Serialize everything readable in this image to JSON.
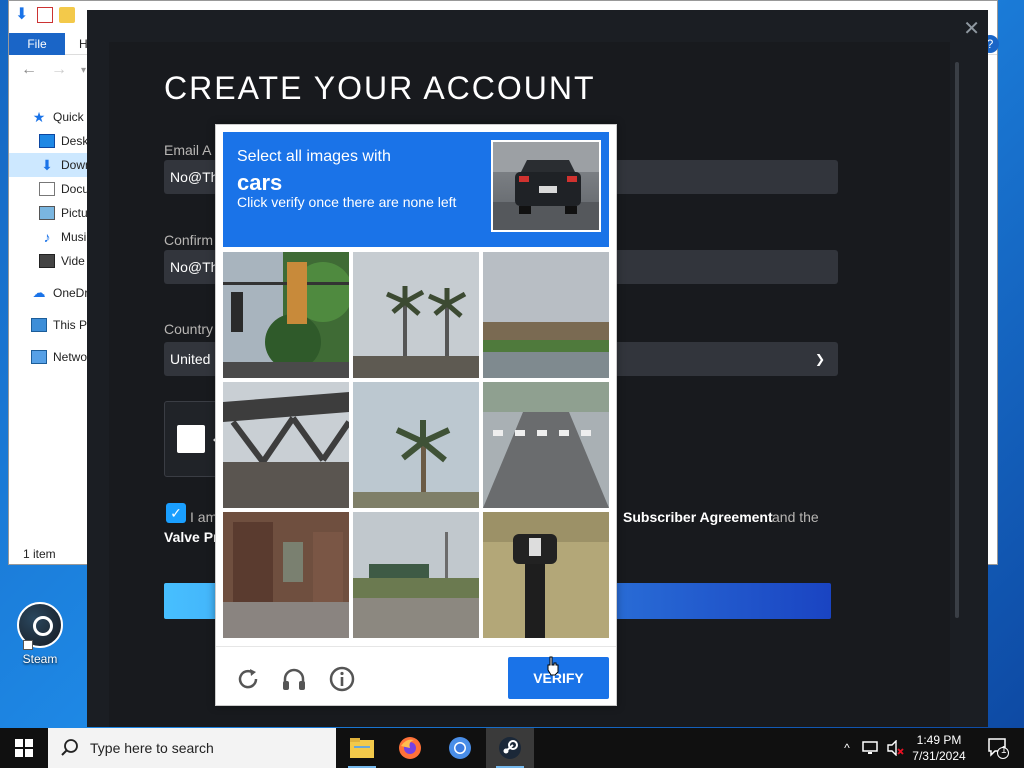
{
  "desktop": {
    "steam_icon_label": "Steam"
  },
  "explorer": {
    "file_tab": "File",
    "home_tab_partial": "H",
    "sidebar": [
      {
        "label": "Quick",
        "icon": "star-icon"
      },
      {
        "label": "Desk",
        "icon": "desktop-icon"
      },
      {
        "label": "Down",
        "icon": "download-icon",
        "selected": true
      },
      {
        "label": "Docu",
        "icon": "documents-icon"
      },
      {
        "label": "Pictu",
        "icon": "pictures-icon"
      },
      {
        "label": "Musi",
        "icon": "music-icon"
      },
      {
        "label": "Vide",
        "icon": "videos-icon"
      },
      {
        "label": "OneDr",
        "icon": "cloud-icon"
      },
      {
        "label": "This P",
        "icon": "computer-icon"
      },
      {
        "label": "Netwo",
        "icon": "network-icon"
      }
    ],
    "status": "1 item"
  },
  "steam": {
    "title": "CREATE YOUR ACCOUNT",
    "email_label": "Email A",
    "email_value": "No@Th",
    "confirm_label": "Confirm",
    "confirm_value": "No@Th",
    "country_label": "Country",
    "country_value": "United",
    "agree_prefix": "I am",
    "agree_link1": "Subscriber Agreement",
    "agree_mid": "and the",
    "agree_link2": "Valve Pr"
  },
  "captcha": {
    "instruction_line1": "Select all images with",
    "target": "cars",
    "instruction_line3": "Click verify once there are none left",
    "verify_label": "VERIFY",
    "tiles": [
      "traffic-light",
      "palm-trees",
      "building",
      "bridge",
      "palm-tree",
      "crosswalk",
      "house-porch",
      "road-field",
      "mailbox"
    ]
  },
  "taskbar": {
    "search_placeholder": "Type here to search",
    "time": "1:49 PM",
    "date": "7/31/2024",
    "notification_count": "1"
  },
  "colors": {
    "captcha_blue": "#1a73e8",
    "steam_bg": "#1b1e23",
    "input_bg": "#32353c",
    "checkbox_blue": "#1a9fff"
  }
}
